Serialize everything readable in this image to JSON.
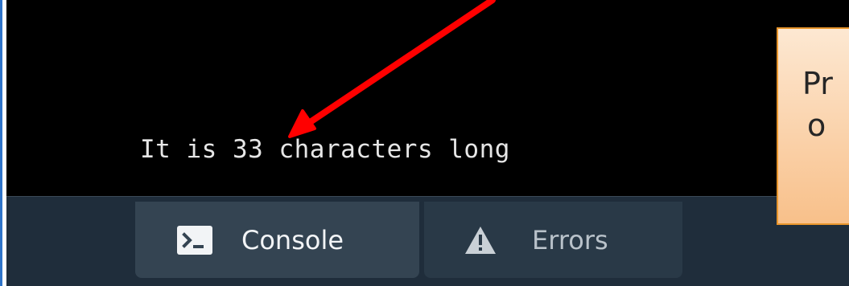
{
  "console": {
    "output_line": "It is 33 characters long"
  },
  "tabs": [
    {
      "label": "Console",
      "icon": "terminal-icon",
      "active": true
    },
    {
      "label": "Errors",
      "icon": "warning-icon",
      "active": false
    }
  ],
  "annotation": {
    "note_lines": [
      "Pr",
      "o"
    ],
    "arrow_color": "#ff0000",
    "note_background": "#fbd4ae",
    "note_border": "#e8952c"
  },
  "colors": {
    "console_bg": "#000000",
    "toolbar_bg": "#1f2d3b",
    "active_tab_bg": "#344452",
    "inactive_tab_bg": "#293947"
  }
}
